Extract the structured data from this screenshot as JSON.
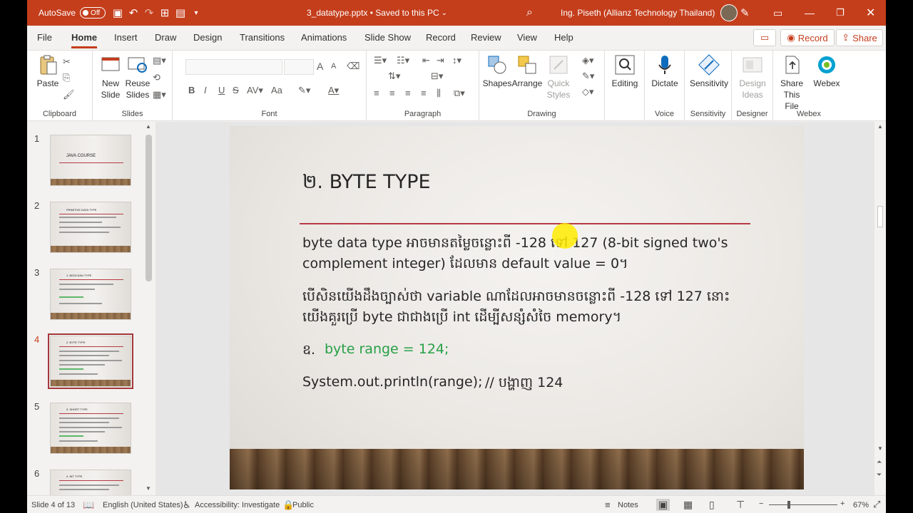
{
  "titlebar": {
    "autosave_label": "AutoSave",
    "autosave_state": "Off",
    "filename": "3_datatype.pptx • Saved to this PC",
    "user": "Ing. Piseth (Allianz Technology Thailand)"
  },
  "tabs": [
    "File",
    "Home",
    "Insert",
    "Draw",
    "Design",
    "Transitions",
    "Animations",
    "Slide Show",
    "Record",
    "Review",
    "View",
    "Help"
  ],
  "active_tab": "Home",
  "buttons": {
    "record": "Record",
    "share": "Share"
  },
  "ribbon": {
    "clipboard": {
      "paste": "Paste",
      "group": "Clipboard"
    },
    "slides": {
      "new_slide_1": "New",
      "new_slide_2": "Slide",
      "reuse_1": "Reuse",
      "reuse_2": "Slides",
      "group": "Slides"
    },
    "font": {
      "group": "Font",
      "bold": "B",
      "italic": "I",
      "underline": "U",
      "strike": "S",
      "case": "Aa",
      "grow": "A",
      "shrink": "A"
    },
    "paragraph": {
      "group": "Paragraph"
    },
    "drawing": {
      "shapes": "Shapes",
      "arrange": "Arrange",
      "quick_1": "Quick",
      "quick_2": "Styles",
      "group": "Drawing"
    },
    "editing": {
      "label": "Editing"
    },
    "voice": {
      "dictate": "Dictate",
      "group": "Voice"
    },
    "sensitivity": {
      "label": "Sensitivity",
      "group": "Sensitivity"
    },
    "designer": {
      "label_1": "Design",
      "label_2": "Ideas",
      "group": "Designer"
    },
    "webex": {
      "share_1": "Share This",
      "share_2": "File",
      "webex": "Webex",
      "group": "Webex"
    }
  },
  "thumbnails": [
    {
      "num": "1",
      "title": "JAVA COURSE"
    },
    {
      "num": "2",
      "title": "PRIMITIVE DATA TYPE"
    },
    {
      "num": "3",
      "title": "1. BOOLEAN TYPE"
    },
    {
      "num": "4",
      "title": "2. BYTE TYPE"
    },
    {
      "num": "5",
      "title": "3. SHORT TYPE"
    },
    {
      "num": "6",
      "title": "4. INT TYPE"
    }
  ],
  "slide": {
    "title": "២. BYTE TYPE",
    "para1_line1": "byte data type អាចមានតម្លៃចន្លោះពី -128 ទៅ 127 (8-bit signed two's",
    "para1_line2": "complement integer) ដែលមាន default value = 0។",
    "para2_line1": "បើសិនយើងដឹងច្បាស់ថា variable ណាដែលអាចមានចន្លោះពី -128 ទៅ 127 នោះ",
    "para2_line2": "យើងគួរប្រើ byte ជាជាងប្រើ int ដើម្បីសន្សំសំចៃ memory។",
    "example_label": "ឧ.",
    "example_code": "byte range = 124;",
    "print_code": "System.out.println(range);",
    "print_comment": "// បង្ហាញ 124"
  },
  "status": {
    "slide_of": "Slide 4 of 13",
    "language": "English (United States)",
    "accessibility": "Accessibility: Investigate",
    "public": "Public",
    "notes": "Notes",
    "zoom": "67%"
  },
  "colors": {
    "accent": "#c43e1c",
    "slide_rule": "#b53a43",
    "code_green": "#27a046"
  }
}
